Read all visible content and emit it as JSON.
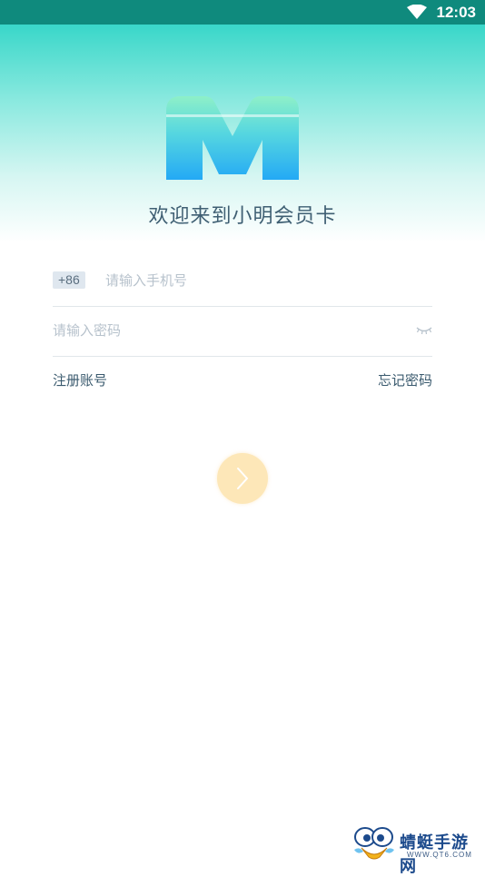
{
  "status_bar": {
    "time": "12:03",
    "wifi_icon": "wifi-icon"
  },
  "header": {
    "welcome_text": "欢迎来到小明会员卡",
    "logo": "m-logo"
  },
  "login_form": {
    "country_code": "+86",
    "phone_placeholder": "请输入手机号",
    "phone_value": "",
    "password_placeholder": "请输入密码",
    "password_value": "",
    "toggle_icon": "eye-closed-icon"
  },
  "links": {
    "register": "注册账号",
    "forgot_password": "忘记密码"
  },
  "submit": {
    "icon": "chevron-right-icon"
  },
  "watermark": {
    "site_name": "蜻蜓手游网",
    "url": "WWW.QT6.COM"
  },
  "colors": {
    "status_bar": "#0f8a7d",
    "hero_top": "#39d7c9",
    "logo_top": "#7fe3c6",
    "logo_bottom": "#2bb3f2",
    "text_primary": "#3f5f73",
    "submit_button": "#fde7b8"
  }
}
